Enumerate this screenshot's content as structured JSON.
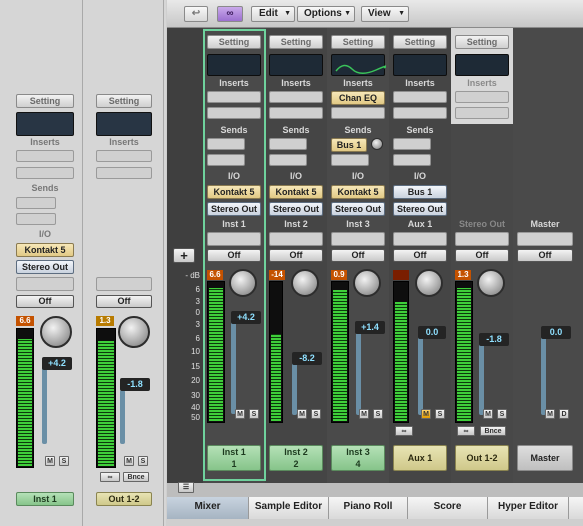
{
  "toolbar": {
    "back_label": "↩",
    "link_label": "∞",
    "menus": [
      {
        "label": "Edit"
      },
      {
        "label": "Options"
      },
      {
        "label": "View"
      }
    ]
  },
  "inspector": {
    "left_strip": {
      "setting": "Setting",
      "inserts": "Inserts",
      "sends": "Sends",
      "io": "I/O",
      "input": "Kontakt 5",
      "output": "Stereo Out",
      "automation": "Off",
      "peak": "6.6",
      "fader_value": "+4.2",
      "mute": "M",
      "solo": "S",
      "name": "Inst 1"
    },
    "right_strip": {
      "setting": "Setting",
      "inserts": "Inserts",
      "automation": "Off",
      "peak": "1.3",
      "fader_value": "-1.8",
      "mute": "M",
      "solo": "S",
      "bounce": "Bnce",
      "name": "Out 1-2"
    }
  },
  "mixer": {
    "add_label": "+",
    "db_label": "- dB",
    "scale": [
      "6",
      "3",
      "0",
      "3",
      "6",
      "10",
      "15",
      "20",
      "30",
      "40",
      "50"
    ],
    "row_labels": {
      "setting": "Setting",
      "inserts": "Inserts",
      "sends": "Sends",
      "io": "I/O"
    },
    "channels": [
      {
        "input": "Kontakt 5",
        "output": "Stereo Out",
        "track": "Inst 1",
        "automation": "Off",
        "peak": "6.6",
        "fader_value": "+4.2",
        "name": "Inst 1",
        "number": "1"
      },
      {
        "input": "Kontakt 5",
        "output": "Stereo Out",
        "track": "Inst 2",
        "automation": "Off",
        "peak": "-14",
        "fader_value": "-8.2",
        "name": "Inst 2",
        "number": "2"
      },
      {
        "insert": "Chan EQ",
        "send": "Bus 1",
        "input": "Kontakt 5",
        "output": "Stereo Out",
        "track": "Inst 3",
        "automation": "Off",
        "peak": "0.9",
        "fader_value": "+1.4",
        "name": "Inst 3",
        "number": "4"
      },
      {
        "input": "Bus 1",
        "output": "Stereo Out",
        "track": "Aux 1",
        "automation": "Off",
        "peak": "",
        "fader_value": "0.0",
        "name": "Aux 1"
      },
      {
        "output_label": "Stereo Out",
        "automation": "Off",
        "peak": "1.3",
        "fader_value": "-1.8",
        "bounce": "Bnce",
        "name": "Out 1-2"
      },
      {
        "output_label": "Master",
        "automation": "Off",
        "fader_value": "0.0",
        "mute": "M",
        "dim": "D",
        "name": "Master"
      }
    ],
    "mute": "M",
    "solo": "S"
  },
  "tabs": [
    {
      "label": "Mixer",
      "selected": true
    },
    {
      "label": "Sample Editor"
    },
    {
      "label": "Piano Roll"
    },
    {
      "label": "Score"
    },
    {
      "label": "Hyper Editor"
    }
  ]
}
